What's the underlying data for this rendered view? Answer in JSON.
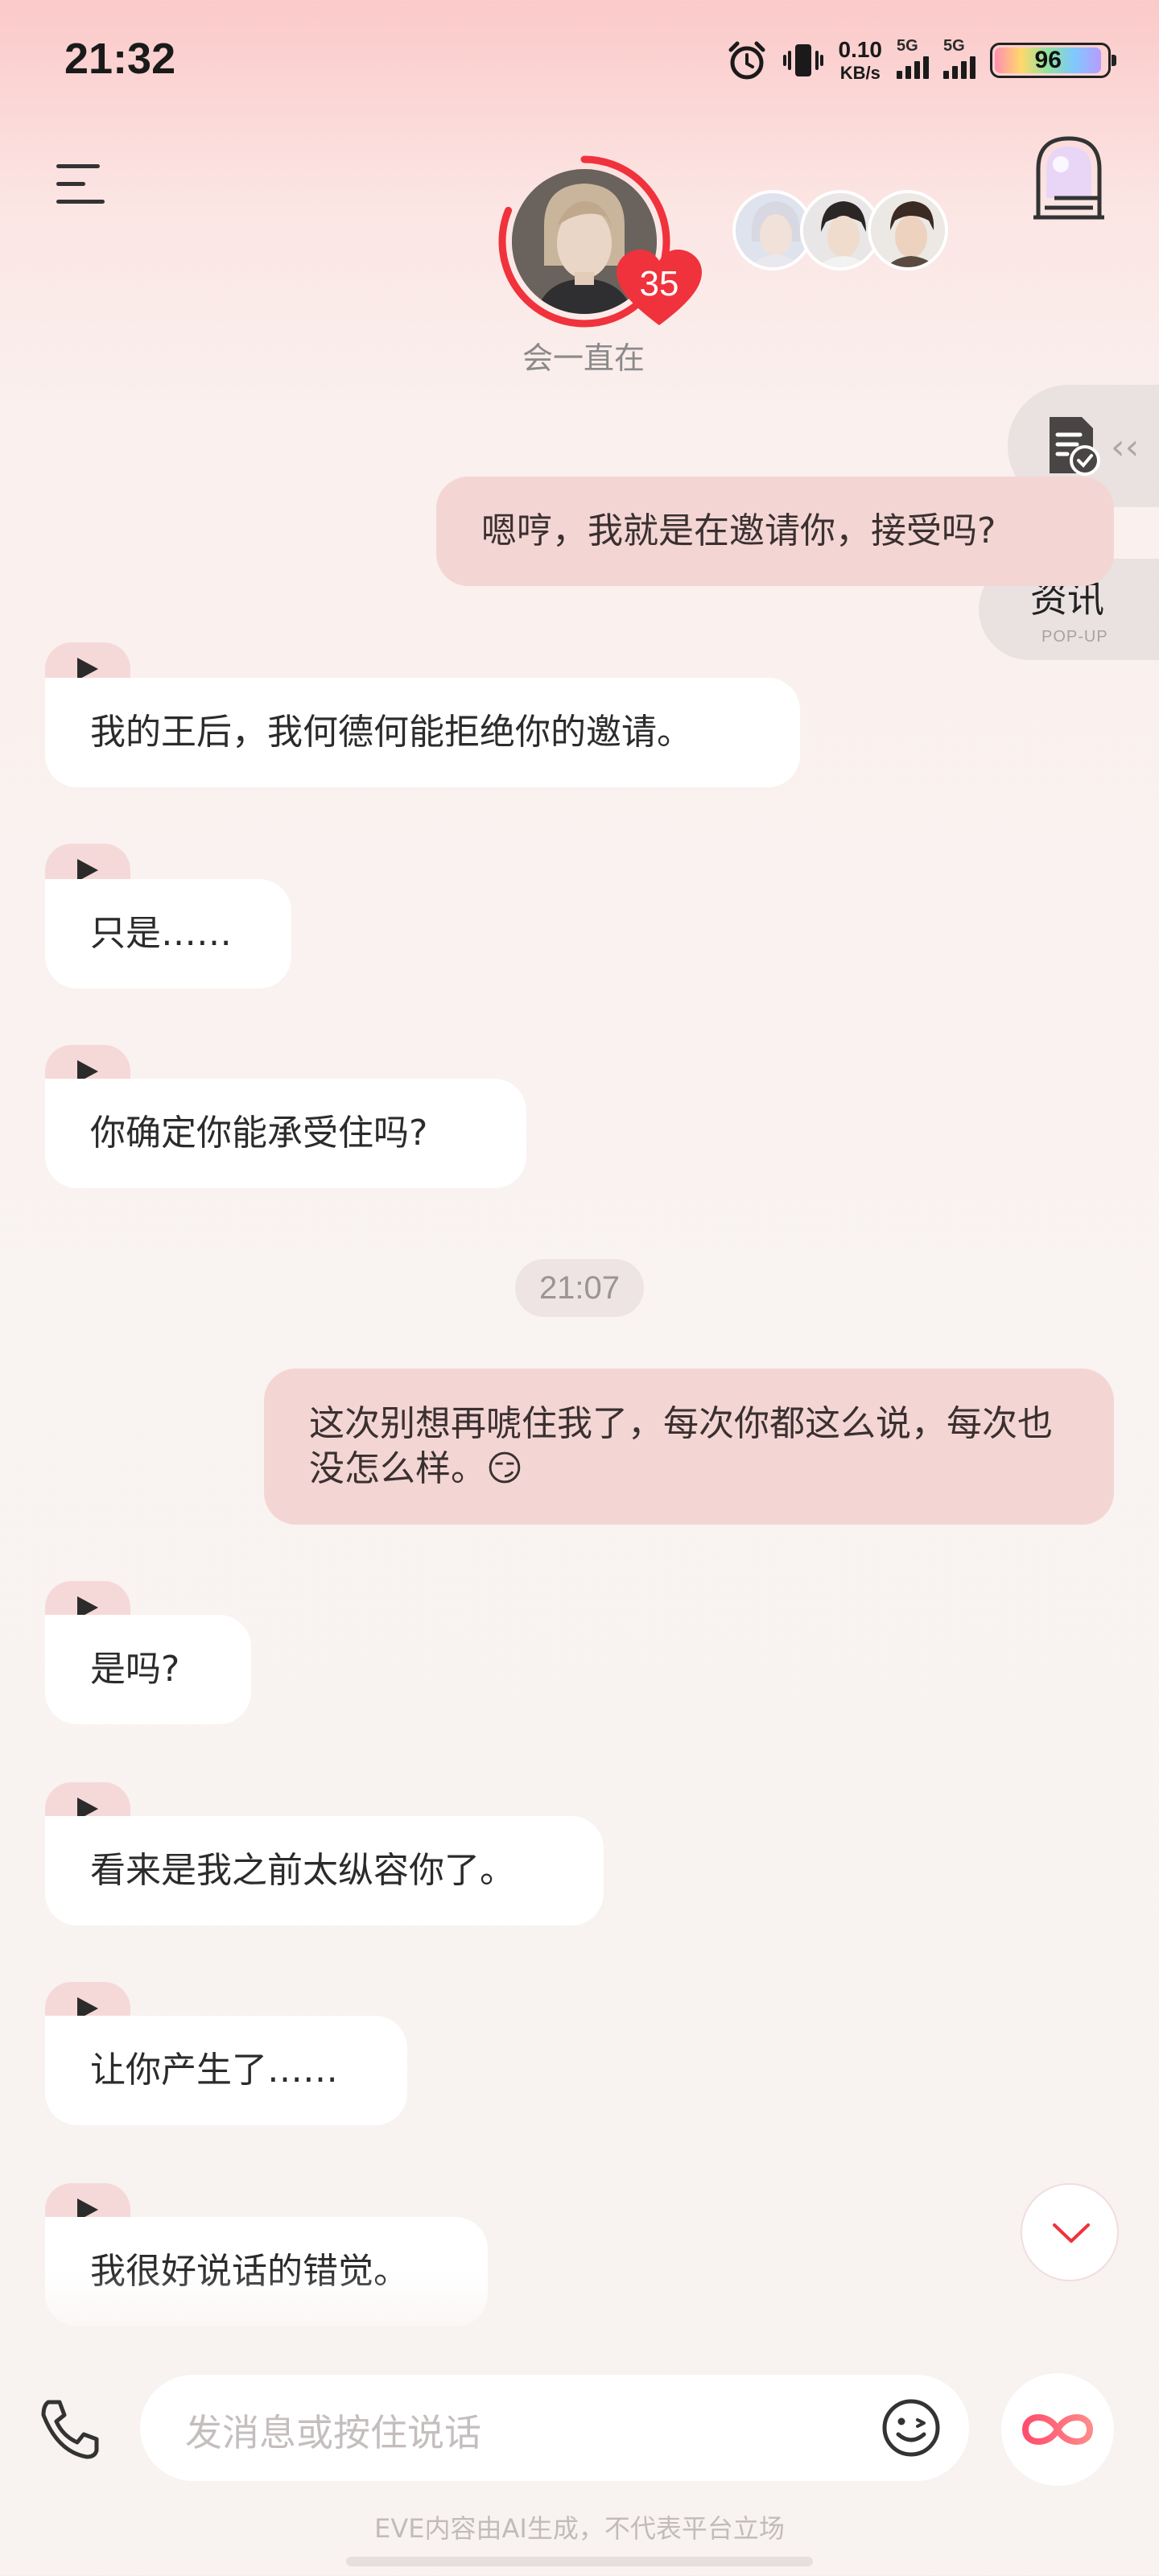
{
  "status_bar": {
    "time": "21:32",
    "net_speed_value": "0.10",
    "net_speed_unit": "KB/s",
    "sim1": "5G",
    "sim2": "5G",
    "battery": "96",
    "icons": [
      "alarm-icon",
      "vibrate-icon",
      "signal-icon",
      "battery-icon"
    ]
  },
  "header": {
    "character_name": "会一直在",
    "affinity_level": "35",
    "icons": [
      "menu-icon",
      "avatar",
      "heart-badge-icon",
      "door-icon"
    ]
  },
  "side": {
    "popup_title": "资讯",
    "popup_sub": "POP-UP",
    "icons": [
      "document-check-icon",
      "chevron-left-icon"
    ]
  },
  "messages": [
    {
      "sender": "user",
      "text": "嗯哼，我就是在邀请你，接受吗?"
    },
    {
      "sender": "bot",
      "text": "我的王后，我何德何能拒绝你的邀请。"
    },
    {
      "sender": "bot",
      "text": "只是……"
    },
    {
      "sender": "bot",
      "text": "你确定你能承受住吗?"
    },
    {
      "sender": "user",
      "text": "这次别想再唬住我了，每次你都这么说，每次也没怎么样。😏"
    },
    {
      "sender": "bot",
      "text": "是吗?"
    },
    {
      "sender": "bot",
      "text": "看来是我之前太纵容你了。"
    },
    {
      "sender": "bot",
      "text": "让你产生了……"
    },
    {
      "sender": "bot",
      "text": "我很好说话的错觉。"
    }
  ],
  "timestamp": "21:07",
  "input": {
    "placeholder": "发消息或按住说话",
    "icons": [
      "phone-icon",
      "emoji-icon",
      "infinity-icon",
      "chevron-down-icon"
    ]
  },
  "disclaimer": "EVE内容由AI生成，不代表平台立场",
  "colors": {
    "accent": "#f0323c",
    "user_bubble": "#f3d6d4",
    "bot_bubble": "#ffffff",
    "play_tab": "#f5d9d8"
  }
}
